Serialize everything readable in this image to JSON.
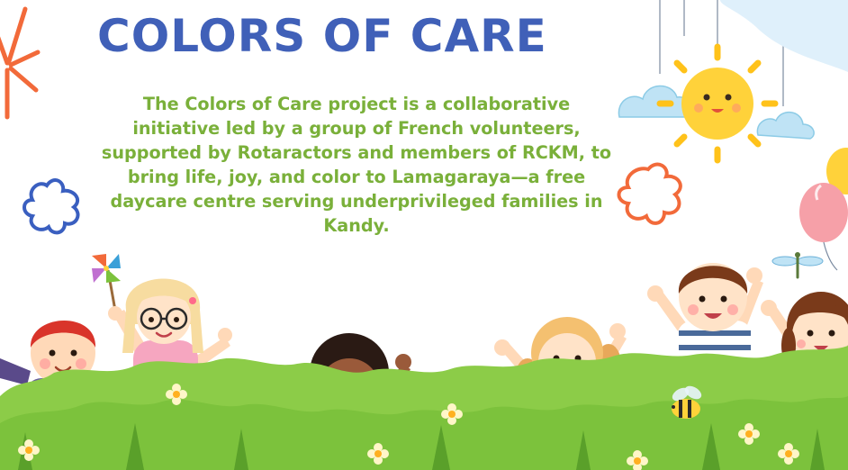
{
  "slide": {
    "title": "COLORS OF CARE",
    "body": "The Colors of Care project is a collaborative initiative led by a group of French volunteers, supported by Rotaractors and members of RCKM, to bring life, joy, and color to Lamagaraya—a free daycare centre serving underprivileged families in Kandy."
  },
  "colors": {
    "title": "#4060b8",
    "body": "#7ab03a",
    "grass": "#7cc23c",
    "grass_dark": "#5aa02a",
    "sun": "#ffd23a",
    "flower_red": "#f26a3a",
    "flower_blue": "#3a5fc0"
  },
  "decorations": {
    "background_icons": [
      "orange-starburst-icon",
      "blue-flower-outline-icon",
      "orange-flower-outline-icon",
      "smiling-sun-icon",
      "cloud-icon",
      "balloon-icon",
      "dragonfly-icon",
      "pinwheel-icon",
      "bee-icon"
    ],
    "characters": [
      "child-red-hair",
      "child-blonde-glasses",
      "child-curly-hair",
      "child-blonde-pigtails",
      "child-brown-hair-striped",
      "child-pigtails-overalls"
    ]
  }
}
